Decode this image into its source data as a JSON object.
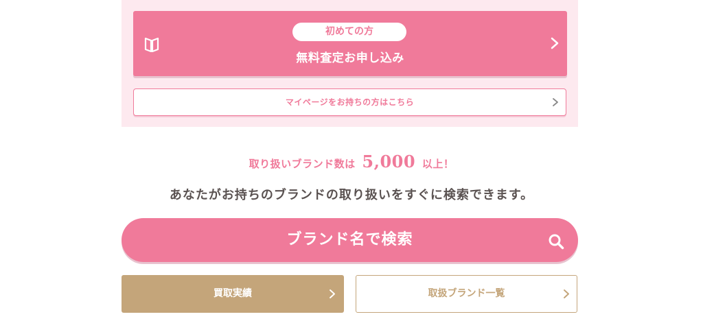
{
  "apply_section": {
    "badge": "初めての方",
    "button_label": "無料査定お申し込み",
    "mypage_label": "マイページをお持ちの方はこちら"
  },
  "brand_info": {
    "prefix": "取り扱いブランド数は",
    "count": "5,000",
    "suffix": "以上！",
    "description": "あなたがお持ちのブランドの取り扱いをすぐに検索できます。"
  },
  "search": {
    "button_label": "ブランド名で検索"
  },
  "bottom_buttons": {
    "results_label": "買取実績",
    "brand_list_label": "取扱ブランド一覧"
  },
  "colors": {
    "pink": "#f07a9a",
    "pink_bg": "#fde9ef",
    "tan": "#c4a57a",
    "text_dark": "#5a5251"
  }
}
